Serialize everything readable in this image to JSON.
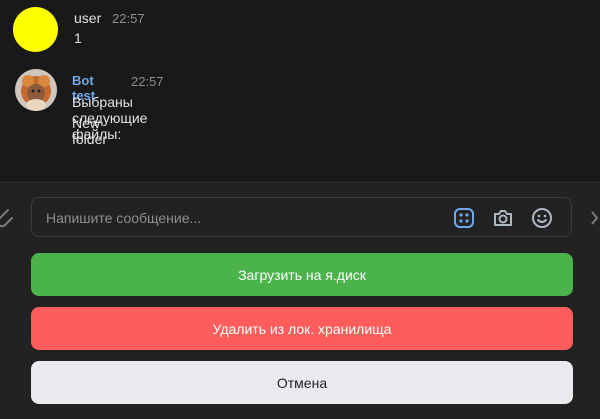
{
  "messages": [
    {
      "author": "user",
      "time": "22:57",
      "lines": [
        "1"
      ]
    },
    {
      "author": "Bot test",
      "time": "22:57",
      "lines": [
        "Выбраны следующие файлы:",
        "New folder"
      ]
    }
  ],
  "composer": {
    "placeholder": "Напишите сообщение..."
  },
  "buttons": {
    "upload": "Загрузить на я.диск",
    "delete": "Удалить из лок. хранилища",
    "cancel": "Отмена"
  },
  "colors": {
    "background": "#191919",
    "bot_name": "#71aaeb",
    "upload_button": "#4bb34b",
    "delete_button": "#ff5c5c",
    "cancel_button": "#e8eaed",
    "user_avatar": "#ffff00"
  },
  "icons": [
    "attach-icon",
    "keyboard-icon",
    "camera-icon",
    "smile-icon"
  ]
}
